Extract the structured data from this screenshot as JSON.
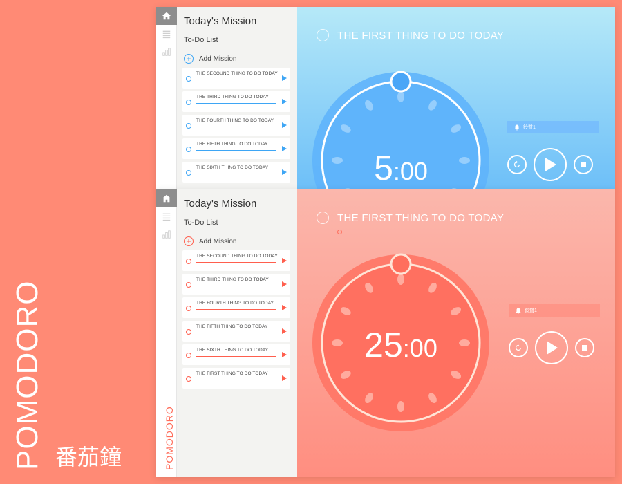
{
  "brand": {
    "title": "POMODORO",
    "subtitle": "番茄鐘"
  },
  "screens": [
    {
      "theme": "blue",
      "sidebar": {
        "title": "Today's Mission",
        "subtitle": "To-Do List",
        "add_label": "Add Mission",
        "tasks": [
          "THE SECOUND THING TO DO TODAY",
          "THE THIRD THING TO DO TODAY",
          "THE FOURTH THING TO DO TODAY",
          "THE FIFTH THING TO DO TODAY",
          "THE SIXTH THING TO DO TODAY"
        ]
      },
      "current_task": "THE FIRST THING TO DO TODAY",
      "timer": {
        "minutes": "5",
        "seconds": "00"
      },
      "alarm_label": "鈴聲1",
      "colors": {
        "accent": "#5fb4fb",
        "ring": "#ffffff"
      }
    },
    {
      "theme": "red",
      "sidebar": {
        "title": "Today's Mission",
        "subtitle": "To-Do List",
        "add_label": "Add Mission",
        "rail_brand": "POMODORO",
        "tasks": [
          "THE SECOUND THING TO DO TODAY",
          "THE THIRD THING TO DO TODAY",
          "THE FOURTH THING TO DO TODAY",
          "THE FIFTH THING TO DO TODAY",
          "THE SIXTH THING TO DO TODAY",
          "THE FIRST THING TO DO TODAY"
        ]
      },
      "current_task": "THE FIRST THING TO DO TODAY",
      "timer": {
        "minutes": "25",
        "seconds": "00"
      },
      "alarm_label": "鈴聲1",
      "colors": {
        "accent": "#ff7060",
        "ring": "#ffe4d6"
      }
    }
  ],
  "icons": {
    "home": "home-icon",
    "list": "list-icon",
    "stats": "chart-icon",
    "bell": "bell-icon",
    "reset": "reset-icon",
    "play": "play-icon",
    "stop": "stop-icon"
  }
}
